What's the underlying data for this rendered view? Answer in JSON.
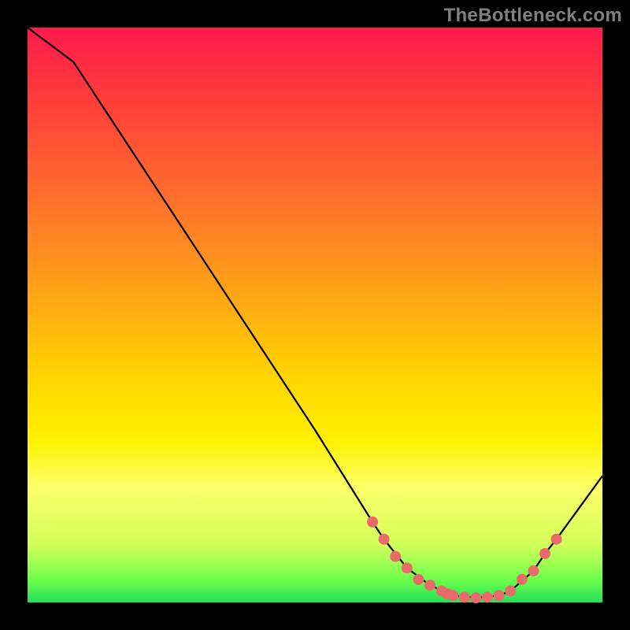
{
  "watermark": "TheBottleneck.com",
  "chart_data": {
    "type": "line",
    "title": "",
    "xlabel": "",
    "ylabel": "",
    "xlim": [
      0,
      100
    ],
    "ylim": [
      0,
      100
    ],
    "series": [
      {
        "name": "line",
        "x": [
          0,
          8,
          50,
          60,
          62,
          66,
          70,
          74,
          78,
          82,
          84,
          88,
          90,
          92,
          100
        ],
        "values": [
          100,
          94,
          30,
          14,
          11,
          6,
          3,
          1.2,
          0.8,
          1.2,
          2,
          5.5,
          8.5,
          11,
          22
        ]
      },
      {
        "name": "points",
        "x": [
          60,
          62,
          64,
          66,
          68,
          70,
          72,
          73,
          74,
          76,
          78,
          80,
          82,
          84,
          86,
          88,
          90,
          92
        ],
        "values": [
          14,
          11,
          8,
          6,
          4,
          3,
          2,
          1.5,
          1.2,
          0.9,
          0.8,
          0.9,
          1.2,
          2,
          4,
          5.5,
          8.5,
          11
        ]
      }
    ],
    "colors": {
      "line_stroke": "#000000",
      "point_fill": "#e86a6a"
    }
  }
}
